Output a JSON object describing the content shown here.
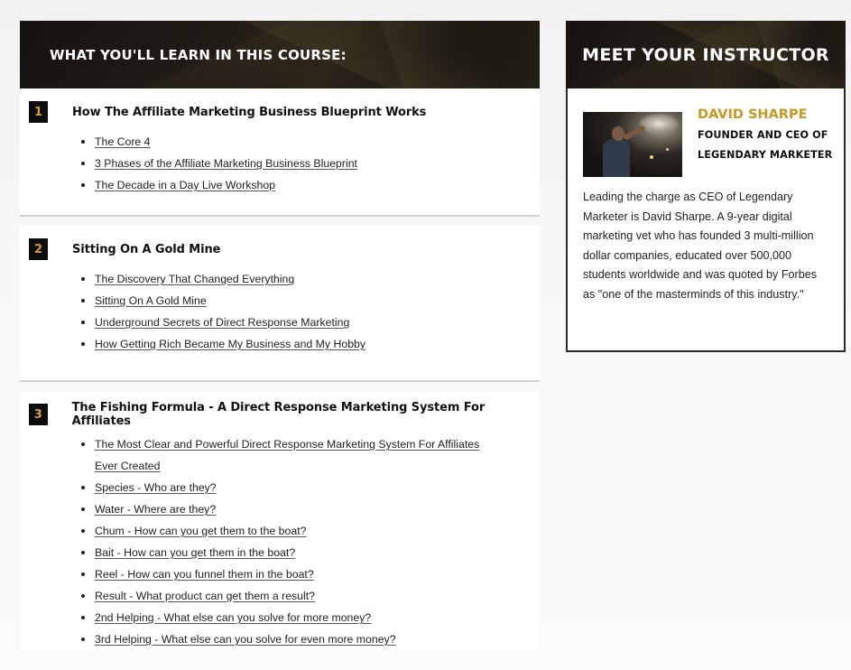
{
  "course": {
    "heading": "WHAT YOU'LL LEARN IN THIS COURSE:",
    "modules": [
      {
        "number": "1",
        "title": "How The Affiliate Marketing Business Blueprint Works",
        "lessons": [
          "The Core 4",
          "3 Phases of the Affiliate Marketing Business Blueprint",
          "The Decade in a Day Live Workshop"
        ]
      },
      {
        "number": "2",
        "title": "Sitting On A Gold Mine",
        "lessons": [
          "The Discovery That Changed Everything",
          "Sitting On A Gold Mine",
          "Underground Secrets of Direct Response Marketing",
          "How Getting Rich Became My Business and My Hobby"
        ]
      },
      {
        "number": "3",
        "title": "The Fishing Formula - A Direct Response Marketing System For Affiliates",
        "lessons": [
          "The Most Clear and Powerful Direct Response Marketing System For Affiliates Ever Created",
          "Species - Who are they?",
          "Water - Where are they?",
          "Chum - How can you get them to the boat?",
          "Bait - How can you get them in the boat?",
          "Reel - How can you funnel them in the boat?",
          "Result - What product can get them a result?",
          "2nd Helping - What else can you solve for more money?",
          "3rd Helping - What else can you solve for even more money?"
        ]
      }
    ]
  },
  "instructor": {
    "heading": "MEET YOUR INSTRUCTOR",
    "name": "DAVID SHARPE",
    "role": "FOUNDER AND CEO OF LEGENDARY MARKETER",
    "bio": "Leading the charge as CEO of Legendary Marketer is David Sharpe. A 9-year digital marketing vet who has founded 3 multi-million dollar companies, educated over 500,000 students worldwide and was quoted by Forbes as \"one of the masterminds of this industry.\"",
    "photo_icon": "instructor-photo"
  },
  "colors": {
    "accent_gold": "#c9971f",
    "number_gold": "#d4a02a",
    "header_dark": "#1f1b15"
  }
}
